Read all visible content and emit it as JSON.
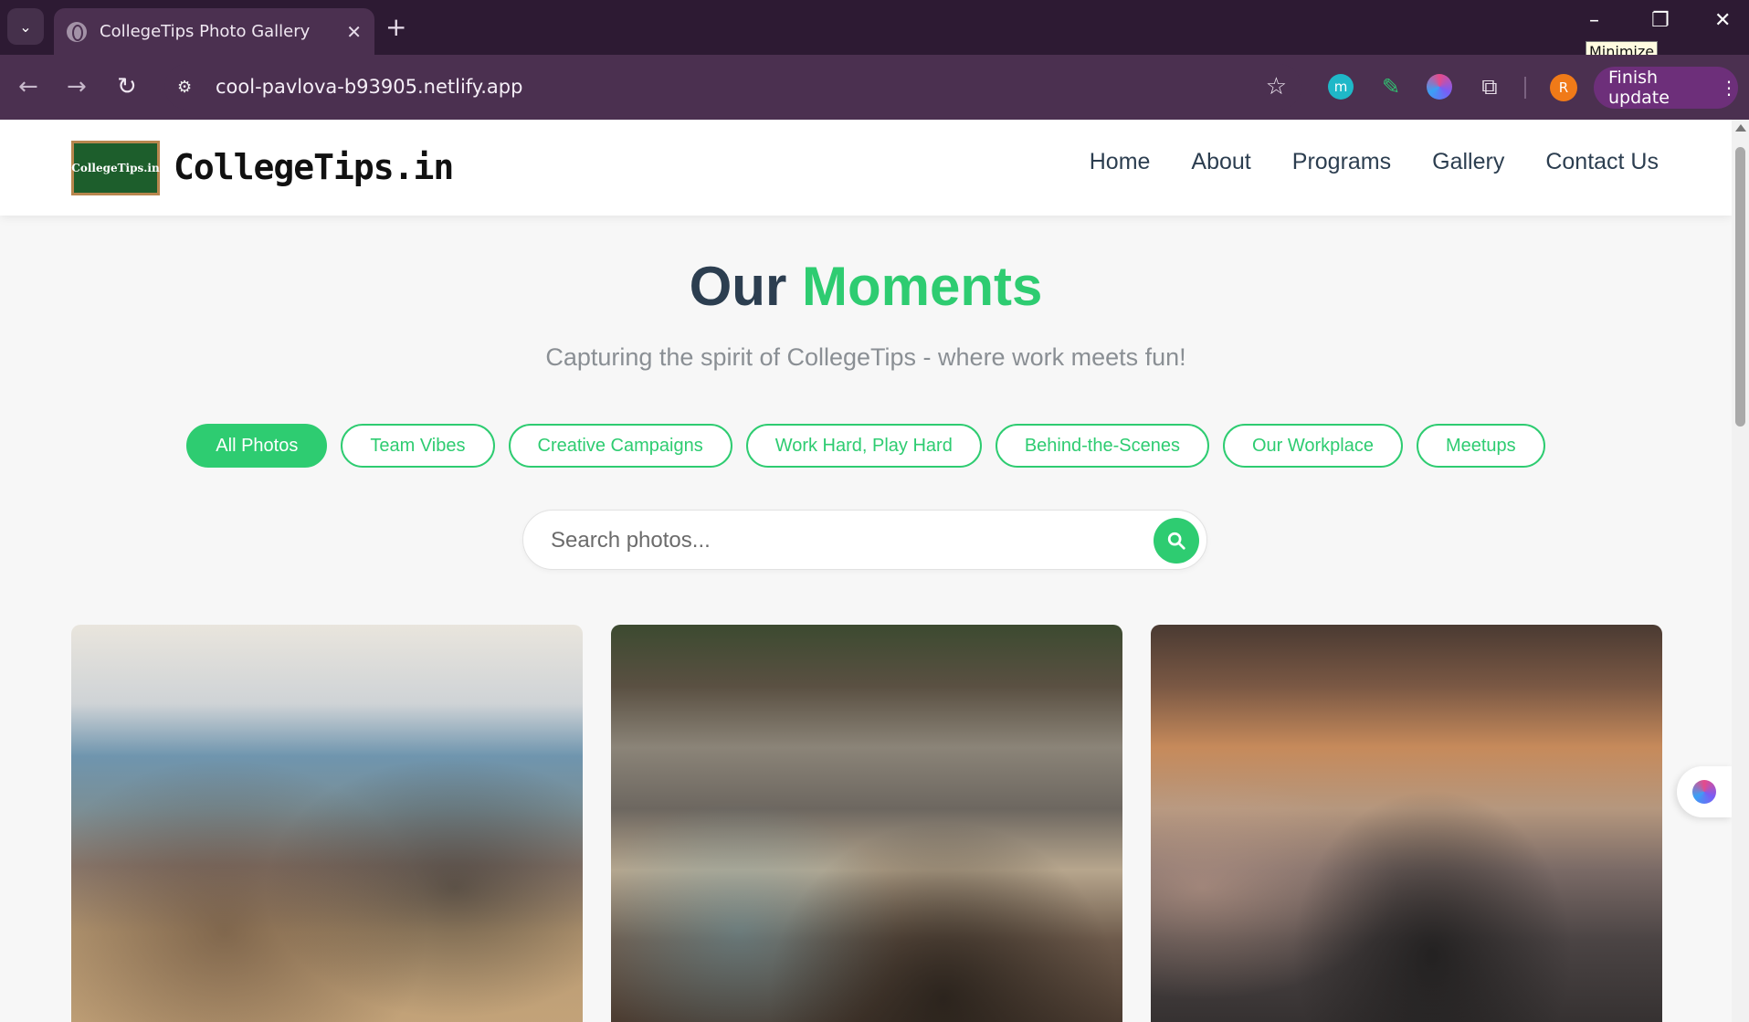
{
  "browser": {
    "tab_title": "CollegeTips Photo Gallery",
    "url": "cool-pavlova-b93905.netlify.app",
    "tooltip": "Minimize",
    "update_label": "Finish update",
    "profile_initial": "R",
    "ext_m_label": "m"
  },
  "site": {
    "logo_badge": "CollegeTips.in",
    "brand": "CollegeTips.in",
    "nav": [
      "Home",
      "About",
      "Programs",
      "Gallery",
      "Contact Us"
    ]
  },
  "hero": {
    "title_plain": "Our ",
    "title_accent": "Moments",
    "subtitle": "Capturing the spirit of CollegeTips - where work meets fun!"
  },
  "filters": [
    "All Photos",
    "Team Vibes",
    "Creative Campaigns",
    "Work Hard, Play Hard",
    "Behind-the-Scenes",
    "Our Workplace",
    "Meetups"
  ],
  "active_filter": "All Photos",
  "search": {
    "placeholder": "Search photos..."
  },
  "colors": {
    "accent": "#2ecc71",
    "heading": "#2c3e50",
    "tab_bar": "#2d1a33",
    "toolbar": "#4b3050"
  }
}
